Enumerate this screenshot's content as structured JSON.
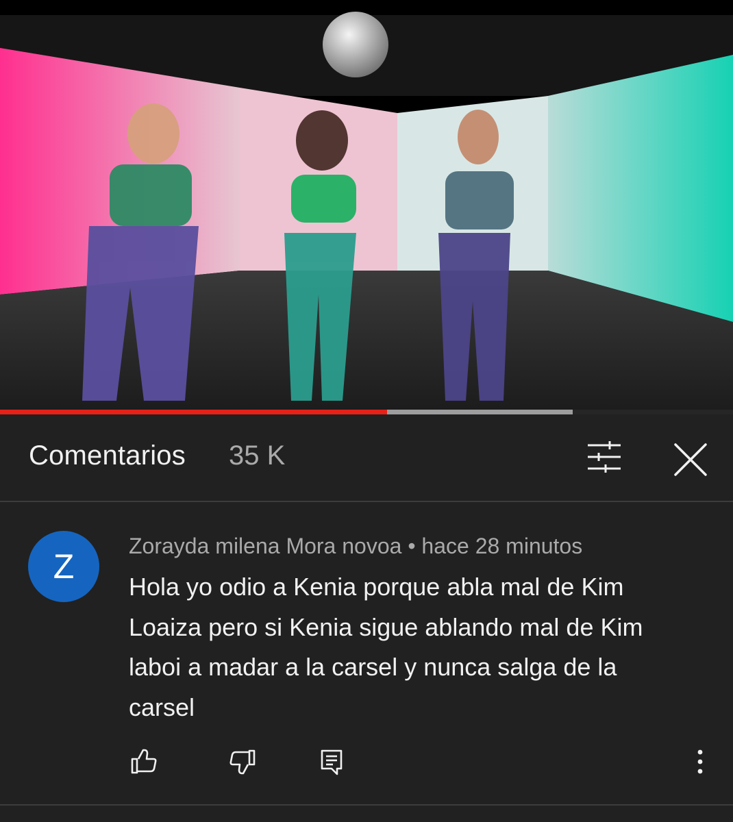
{
  "video": {
    "progress_fraction": 0.528,
    "buffered_fraction": 0.781
  },
  "comments_panel": {
    "title": "Comentarios",
    "count": "35 K",
    "filter_icon": "sort-filter-icon",
    "close_icon": "close-icon"
  },
  "comment": {
    "avatar_letter": "Z",
    "avatar_color": "#1565c0",
    "meta": "Zorayda milena Mora novoa • hace 28 minutos",
    "text_lines": [
      "Hola yo odio a Kenia porque abla mal de Kim",
      "Loaiza pero si Kenia sigue ablando mal de Kim",
      "laboi a madar a la carsel y nunca salga de la",
      "carsel"
    ],
    "actions": [
      "like-icon",
      "dislike-icon",
      "reply-icon",
      "more-vert-icon"
    ]
  },
  "colors": {
    "background": "#212121",
    "progress_played": "#e62117",
    "progress_buffered": "#9e9e9e"
  }
}
